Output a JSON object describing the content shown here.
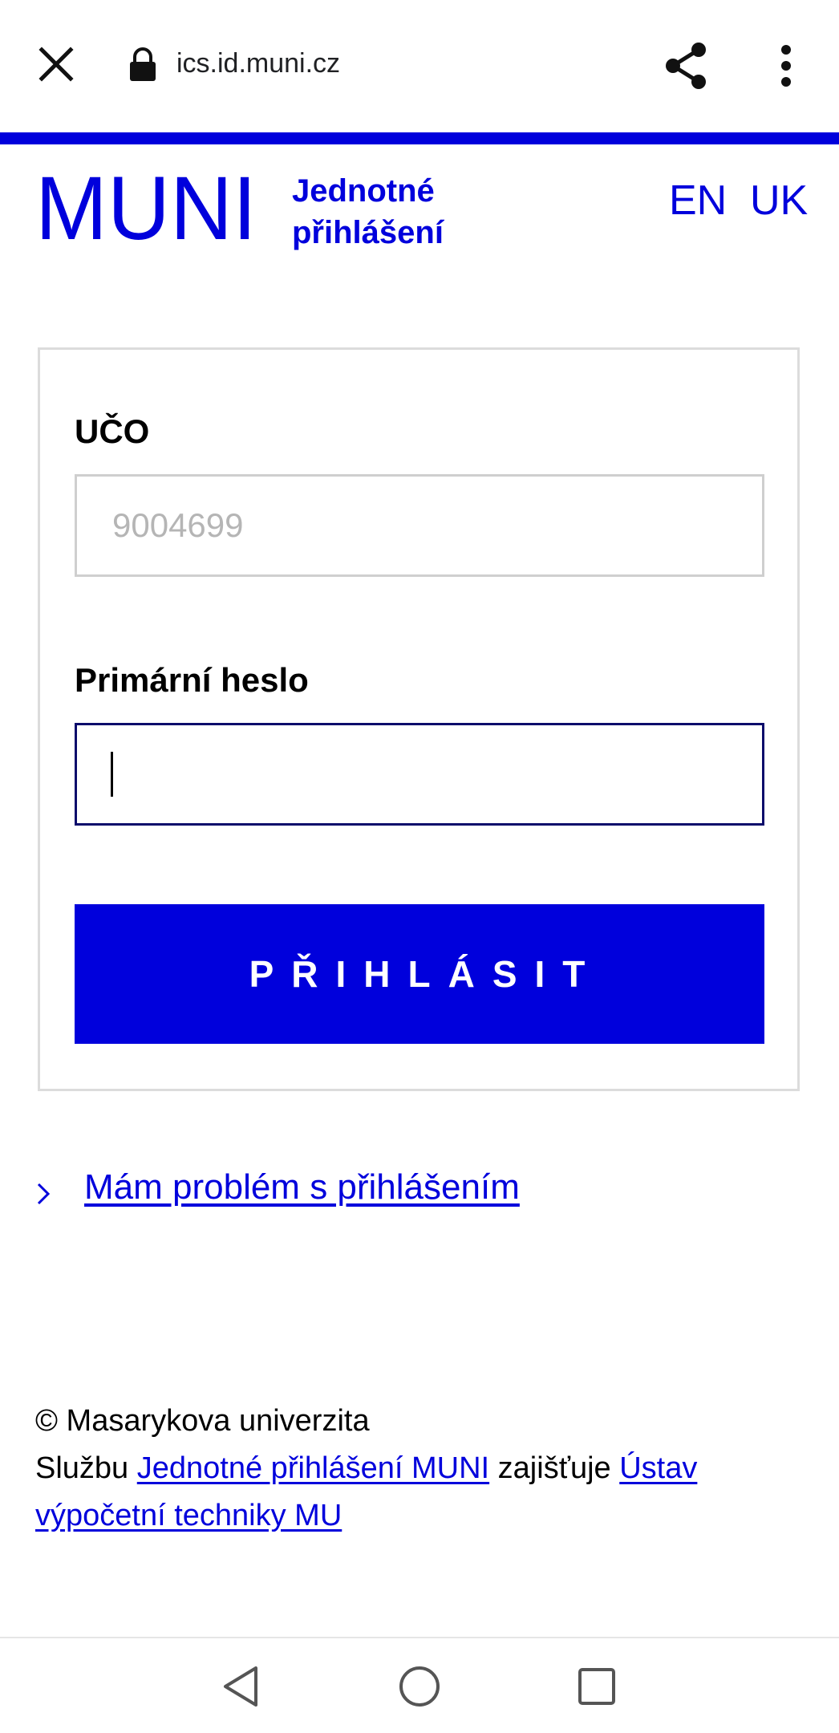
{
  "browser": {
    "url": "ics.id.muni.cz",
    "icons": [
      "close-icon",
      "lock-icon",
      "share-icon",
      "more-vert-icon"
    ]
  },
  "header": {
    "logo_text": "MUNI",
    "subtitle_line1": "Jednotné",
    "subtitle_line2": "přihlášení",
    "languages": [
      "EN",
      "UK"
    ]
  },
  "form": {
    "uco_label": "UČO",
    "uco_placeholder": "9004699",
    "uco_value": "",
    "password_label": "Primární heslo",
    "password_value": "",
    "submit_label": "PŘIHLÁSIT"
  },
  "help": {
    "link_text": "Mám problém s přihlášením"
  },
  "footer": {
    "copyright": "© Masarykova univerzita",
    "service_prefix": "Službu",
    "service_link": "Jednotné přihlášení MUNI",
    "service_middle": "zajišťuje",
    "provider_link": "Ústav výpočetní techniky MU"
  },
  "colors": {
    "accent": "#0000dc",
    "input_focus_border": "#0b0b6b",
    "input_border": "#cfcfcf",
    "card_border": "#dcdcdc"
  },
  "navbar": {
    "icons": [
      "back-icon",
      "home-icon",
      "recent-apps-icon"
    ]
  }
}
